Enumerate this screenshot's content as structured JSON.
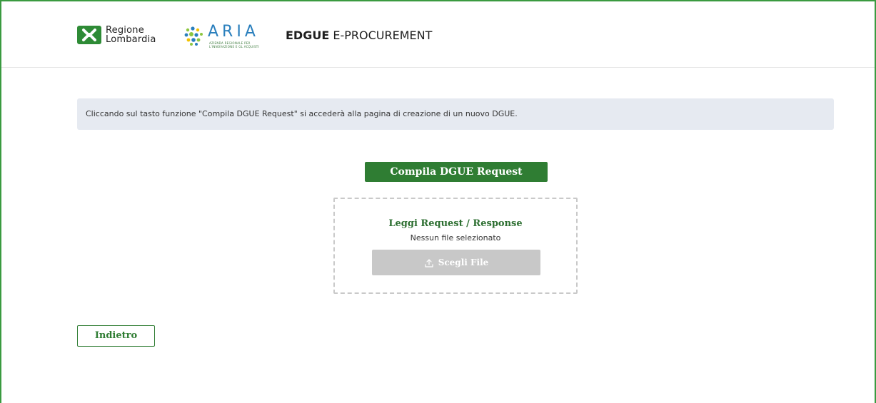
{
  "header": {
    "logo_rl_line1": "Regione",
    "logo_rl_line2": "Lombardia",
    "logo_aria_word": "ARIA",
    "logo_aria_sub1": "AZIENDA REGIONALE PER",
    "logo_aria_sub2": "L'INNOVAZIONE E GL ACQUISTI",
    "app_title_bold": "EDGUE",
    "app_title_rest": " E-PROCUREMENT"
  },
  "info_banner": {
    "text": "Cliccando sul tasto funzione \"Compila DGUE Request\" si accederà alla pagina di creazione di un nuovo DGUE."
  },
  "actions": {
    "compile_label": "Compila DGUE Request"
  },
  "upload": {
    "title": "Leggi Request / Response",
    "status": "Nessun file selezionato",
    "choose_label": "Scegli File",
    "choose_icon": "upload-icon"
  },
  "footer": {
    "back_label": "Indietro"
  },
  "colors": {
    "brand_green": "#2f7d33",
    "frame_green": "#3a9a40",
    "aria_blue": "#2a7fbd",
    "banner_bg": "#e6eaf1",
    "disabled_gray": "#c8c8c8"
  }
}
